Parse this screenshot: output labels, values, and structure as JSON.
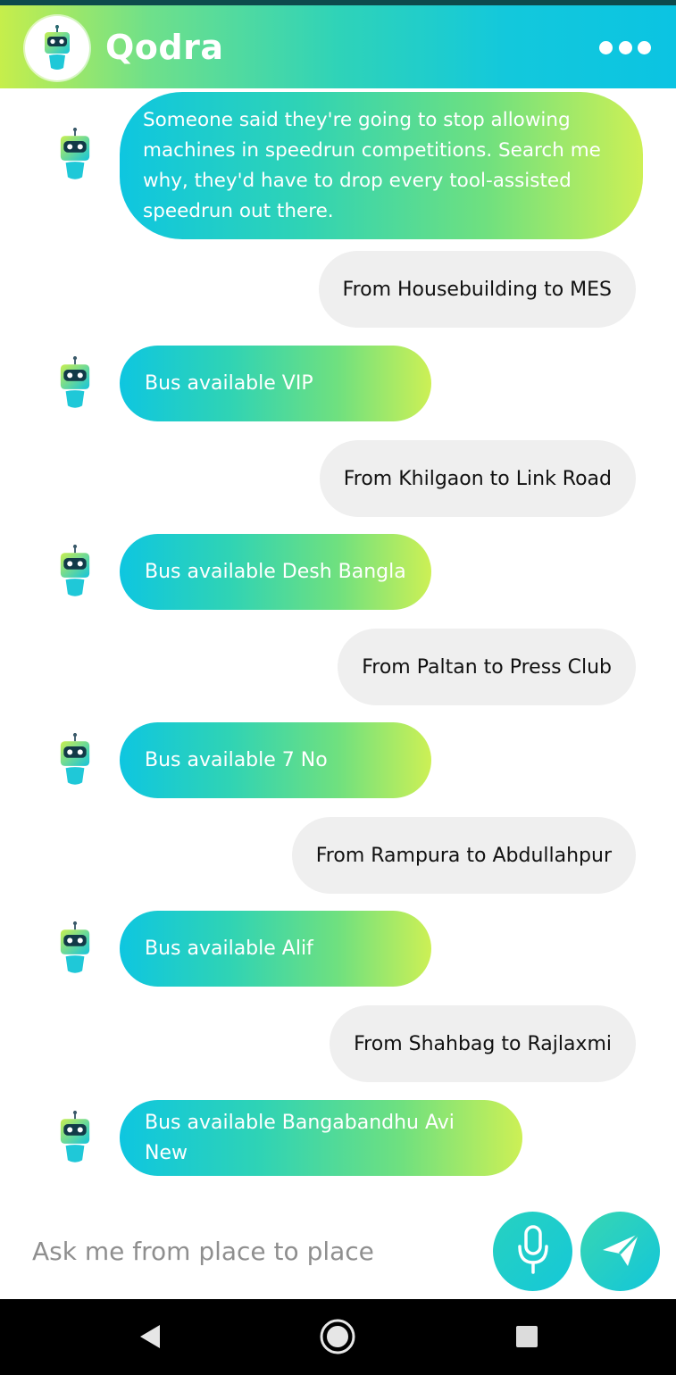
{
  "app": {
    "title": "Qodra",
    "colors": {
      "header_gradient_start": "#c6ee4b",
      "header_gradient_end": "#0bc4e2",
      "bot_bubble_start": "#0ec6e0",
      "bot_bubble_end": "#cdf055",
      "user_bubble": "#efefef"
    }
  },
  "header": {
    "logo_icon": "robot-logo-icon",
    "menu_icon": "more-horizontal-icon"
  },
  "messages": [
    {
      "sender": "bot",
      "text": "Someone said they're going to stop allowing machines in speedrun competitions. Search me why, they'd have to drop every tool-assisted speedrun out there."
    },
    {
      "sender": "user",
      "text": "From Housebuilding to MES"
    },
    {
      "sender": "bot",
      "text": "Bus available VIP"
    },
    {
      "sender": "user",
      "text": "From Khilgaon to Link Road"
    },
    {
      "sender": "bot",
      "text": "Bus available Desh Bangla"
    },
    {
      "sender": "user",
      "text": "From Paltan to Press Club"
    },
    {
      "sender": "bot",
      "text": "Bus available 7 No"
    },
    {
      "sender": "user",
      "text": "From Rampura to Abdullahpur"
    },
    {
      "sender": "bot",
      "text": "Bus available Alif"
    },
    {
      "sender": "user",
      "text": "From Shahbag to Rajlaxmi"
    },
    {
      "sender": "bot",
      "text": "Bus available Bangabandhu Avi New"
    }
  ],
  "composer": {
    "placeholder": "Ask me from place to place",
    "value": "",
    "mic_icon": "microphone-icon",
    "send_icon": "send-icon"
  },
  "system_nav": {
    "back_icon": "back-triangle-icon",
    "home_icon": "home-circle-icon",
    "recents_icon": "recents-square-icon"
  }
}
